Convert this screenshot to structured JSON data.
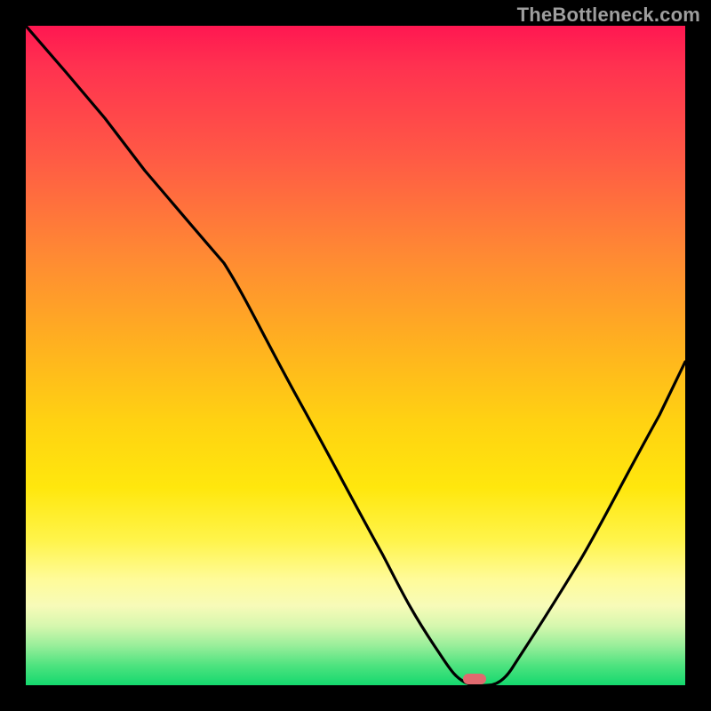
{
  "watermark": "TheBottleneck.com",
  "colors": {
    "frame_bg": "#000000",
    "watermark_text": "#9e9e9e",
    "curve_stroke": "#000000",
    "marker_fill": "#e06a6f",
    "gradient_top": "#ff1751",
    "gradient_bottom": "#14d86e"
  },
  "chart_data": {
    "type": "line",
    "title": "",
    "xlabel": "",
    "ylabel": "",
    "x_range": [
      0,
      100
    ],
    "y_range": [
      0,
      100
    ],
    "grid": false,
    "legend": false,
    "background": "vertical-gradient red→orange→yellow→green (bottleneck heatmap)",
    "series": [
      {
        "name": "bottleneck-curve",
        "note": "Values are approximate, read off the unlabeled heatmap by vertical position (0=bottom/green, 100=top/red).",
        "x": [
          0,
          6,
          12,
          18,
          24,
          30,
          36,
          42,
          48,
          54,
          58,
          62,
          65,
          67,
          70,
          74,
          78,
          84,
          90,
          96,
          100
        ],
        "y": [
          100,
          93,
          86,
          78,
          72,
          64,
          53,
          42,
          31,
          20,
          12,
          5,
          1,
          0,
          0,
          3,
          9,
          19,
          30,
          41,
          49
        ]
      }
    ],
    "marker": {
      "name": "optimal-point",
      "x": 68,
      "y": 0,
      "shape": "rounded-rect",
      "color": "#e06a6f"
    }
  }
}
